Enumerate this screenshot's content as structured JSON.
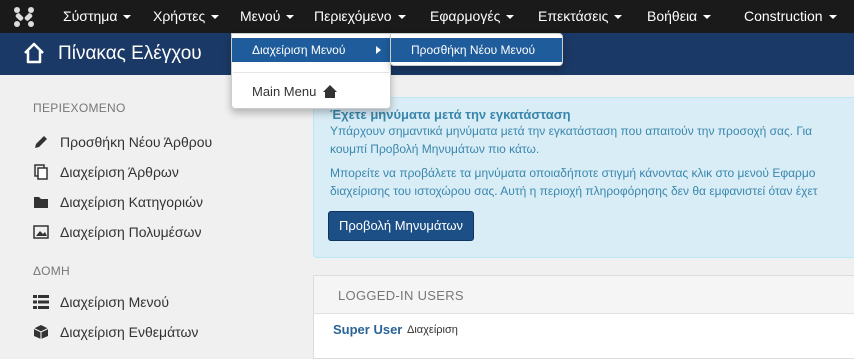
{
  "navbar": {
    "items": [
      {
        "label": "Σύστημα"
      },
      {
        "label": "Χρήστες"
      },
      {
        "label": "Μενού"
      },
      {
        "label": "Περιεχόμενο"
      },
      {
        "label": "Εφαρμογές"
      },
      {
        "label": "Επεκτάσεις"
      },
      {
        "label": "Βοήθεια"
      },
      {
        "label": "Construction"
      }
    ]
  },
  "header": {
    "title": "Πίνακας Ελέγχου"
  },
  "sidebar": {
    "content_heading": "ΠΕΡΙΕΧΟΜΕΝΟ",
    "content_items": [
      {
        "label": "Προσθήκη Νέου Άρθρου",
        "icon": "pencil-icon"
      },
      {
        "label": "Διαχείριση Άρθρων",
        "icon": "copy-icon"
      },
      {
        "label": "Διαχείριση Κατηγοριών",
        "icon": "folder-icon"
      },
      {
        "label": "Διαχείριση Πολυμέσων",
        "icon": "image-icon"
      }
    ],
    "structure_heading": "ΔΟΜΗ",
    "structure_items": [
      {
        "label": "Διαχείριση Μενού",
        "icon": "list-icon"
      },
      {
        "label": "Διαχείριση Ενθεμάτων",
        "icon": "cube-icon"
      }
    ]
  },
  "info": {
    "title": "Έχετε μηνύματα μετά την εγκατάσταση",
    "line1": "Υπάρχουν σημαντικά μηνύματα μετά την εγκατάσταση που απαιτούν την προσοχή σας. Για",
    "line2": "κουμπί Προβολή Μηνυμάτων πιο κάτω.",
    "line3": "Μπορείτε να προβάλετε τα μηνύματα οποιαδήποτε στιγμή κάνοντας κλικ στο μενού Εφαρμο",
    "line4": "διαχείρισης του ιστοχώρου σας. Αυτή η περιοχή πληροφόρησης δεν θα εμφανιστεί όταν έχετ",
    "button": "Προβολή Μηνυμάτων"
  },
  "users": {
    "heading": "LOGGED-IN USERS",
    "name": "Super User",
    "role": "Διαχείριση"
  },
  "menu_dropdown": {
    "item1": "Διαχείριση Μενού",
    "item2": "Main Menu"
  },
  "submenu": {
    "item1": "Προσθήκη Νέου Μενού"
  },
  "colors": {
    "navbar": "#1a1a1a",
    "header": "#1b3966",
    "highlight": "#1f5c9c",
    "info_bg": "#d9edf7",
    "info_text": "#3a87ad"
  }
}
